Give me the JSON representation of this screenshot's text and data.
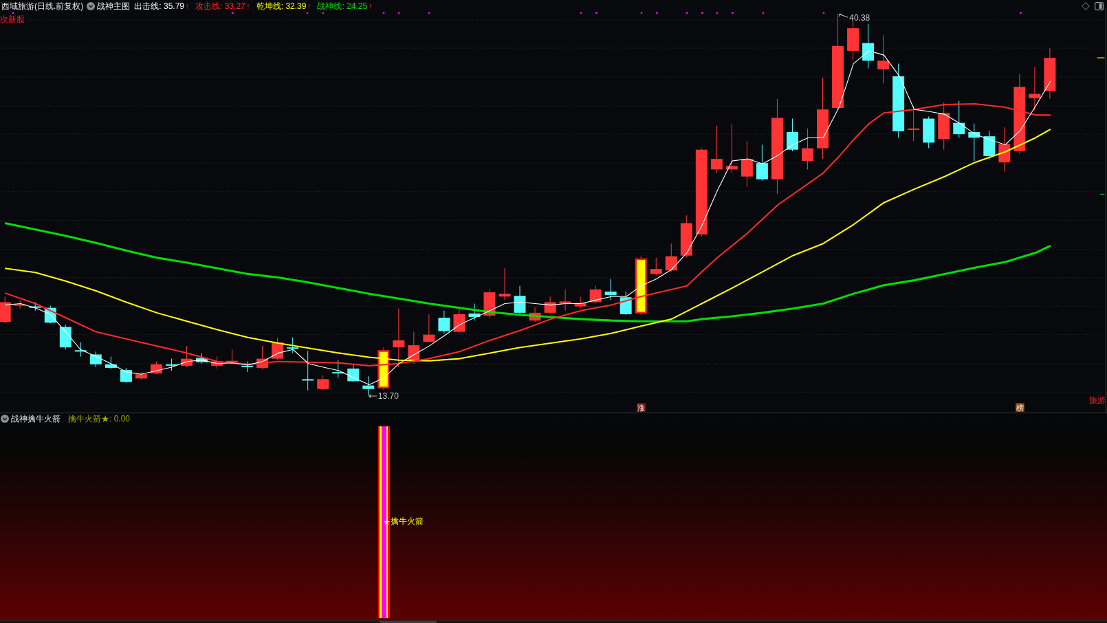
{
  "main_chart": {
    "title": "西域旅游(日线.前复权)",
    "indicator_name": "战神主图",
    "indicators": [
      {
        "label": "出击线: 35.79",
        "arrow": "↑",
        "color": "#ffffff"
      },
      {
        "label": "攻击线: 33.27",
        "arrow": "↑",
        "color": "#ff2a2a"
      },
      {
        "label": "乾坤线: 32.39",
        "arrow": "↑",
        "color": "#ffff00"
      },
      {
        "label": "战神线: 24.25",
        "arrow": "↑",
        "color": "#00dd00"
      }
    ],
    "sector_tag": "次新股",
    "high_label": "40.38",
    "low_label": "13.70",
    "event_tags": [
      {
        "text": "涨",
        "color": "#8b0a0a"
      },
      {
        "text": "榜",
        "color": "#8b4a12"
      }
    ],
    "concept_label": "旅游"
  },
  "sub_chart": {
    "indicator_name": "战神擒牛火箭",
    "reading": "擒牛火箭★: 0.00",
    "signal_label": "擒牛火箭"
  }
}
